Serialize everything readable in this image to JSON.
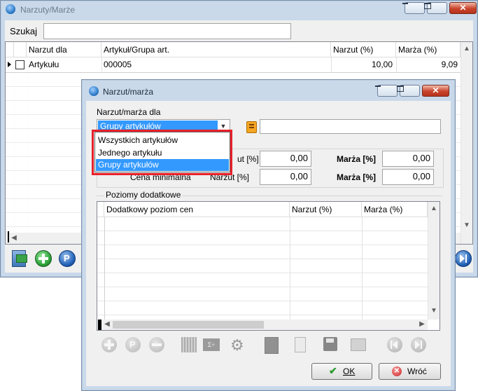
{
  "main_window": {
    "title": "Narzuty/Marże",
    "search_label": "Szukaj",
    "search_value": "",
    "columns": [
      "Narzut dla",
      "Artykuł/Grupa art.",
      "Narzut (%)",
      "Marża (%)"
    ],
    "rows": [
      {
        "narzut_dla": "Artykułu",
        "artykul": "000005",
        "narzut": "10,00",
        "marza": "9,09"
      }
    ]
  },
  "dialog": {
    "title": "Narzut/marża",
    "narzut_marza_dla_label": "Narzut/marża dla",
    "combo_selected": "Grupy artykułów",
    "combo_options": [
      "Wszystkich artykułów",
      "Jednego artykułu",
      "Grupy artykułów"
    ],
    "group_value": "",
    "row1": {
      "narzut_label": "ut [%]",
      "narzut_value": "0,00",
      "marza_label": "Marża [%]",
      "marza_value": "0,00"
    },
    "row2": {
      "caption": "Cena minimalna",
      "narzut_label": "Narzut [%]",
      "narzut_value": "0,00",
      "marza_label": "Marża [%]",
      "marza_value": "0,00"
    },
    "poziomy_label": "Poziomy dodatkowe",
    "levels_columns": [
      "Dodatkowy poziom cen",
      "Narzut (%)",
      "Marża (%)"
    ],
    "ok_label": "OK",
    "cancel_label": "Wróć"
  },
  "colors": {
    "selection": "#3399ff",
    "highlight_border": "#e8202a",
    "add_green": "#2ea43a",
    "nav_blue": "#1f5fb5"
  }
}
